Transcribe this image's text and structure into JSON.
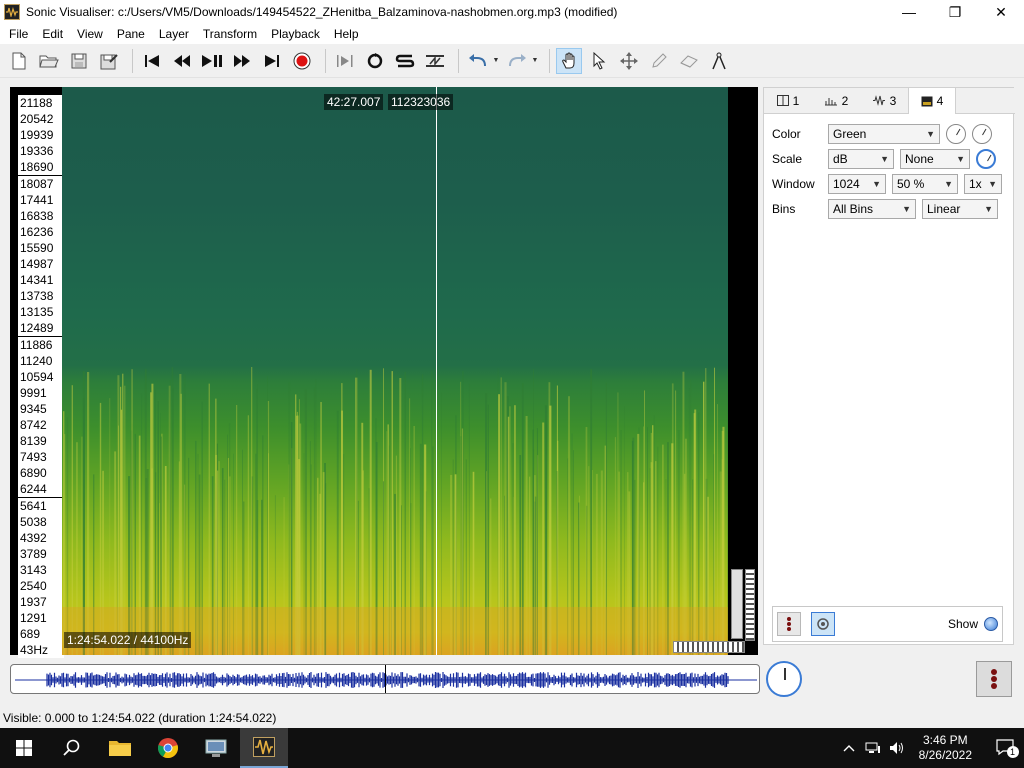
{
  "window": {
    "title": "Sonic Visualiser: c:/Users/VM5/Downloads/149454522_ZHenitba_Balzaminova-nashobmen.org.mp3 (modified)",
    "minimize": "—",
    "maximize": "❐",
    "close": "✕"
  },
  "menu": [
    "File",
    "Edit",
    "View",
    "Pane",
    "Layer",
    "Transform",
    "Playback",
    "Help"
  ],
  "pane": {
    "frequency_labels": [
      "21188",
      "20542",
      "19939",
      "19336",
      "18690",
      "18087",
      "17441",
      "16838",
      "16236",
      "15590",
      "14987",
      "14341",
      "13738",
      "13135",
      "12489",
      "11886",
      "11240",
      "10594",
      "9991",
      "9345",
      "8742",
      "8139",
      "7493",
      "6890",
      "6244",
      "5641",
      "5038",
      "4392",
      "3789",
      "3143",
      "2540",
      "1937",
      "1291",
      "689",
      "43Hz"
    ],
    "cursor_time": "42:27.007",
    "cursor_frame": "112323036",
    "duration_rate": "1:24:54.022 / 44100Hz",
    "colors": {
      "background": "#1c5a4a",
      "low_band": "#d8a820",
      "mid_band": "#63a524"
    }
  },
  "properties": {
    "tabs": [
      {
        "label": "1",
        "icon": "pane-icon"
      },
      {
        "label": "2",
        "icon": "ruler-icon"
      },
      {
        "label": "3",
        "icon": "waveform-icon"
      },
      {
        "label": "4",
        "icon": "spectrogram-icon"
      }
    ],
    "color": {
      "label": "Color",
      "value": "Green"
    },
    "scale": {
      "label": "Scale",
      "value": "dB",
      "normalize": "None"
    },
    "window": {
      "label": "Window",
      "size": "1024",
      "overlap": "50 %",
      "oversampling": "1x"
    },
    "bins": {
      "label": "Bins",
      "display": "All Bins",
      "frequency_scale": "Linear"
    },
    "show_label": "Show"
  },
  "status": "Visible: 0.000 to 1:24:54.022 (duration 1:24:54.022)",
  "taskbar": {
    "time": "3:46 PM",
    "date": "8/26/2022",
    "notifications": "1"
  }
}
